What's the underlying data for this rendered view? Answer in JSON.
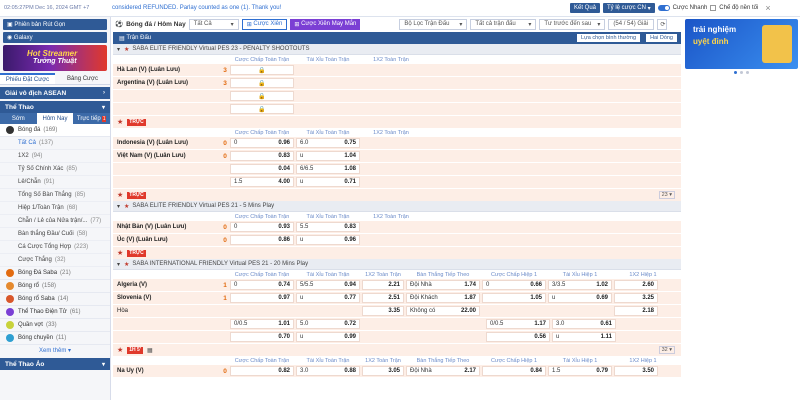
{
  "topbar": {
    "clock": "02:05:27PM Dec 16, 2024 GMT +7",
    "notice": "considered REFUNDED. Parlay counted as one (1). Thank you!",
    "result_btn": "Kết Quả",
    "rate_select": "Tỷ lệ cược CN",
    "fast_bet": "Cược Nhanh",
    "bg_mode": "Chế độ nền tối"
  },
  "sidebar": {
    "btn1": "Phiên bản Rút Gọn",
    "btn2": "Galaxy",
    "banner_line1": "Hot Streamer",
    "banner_line2": "Tưởng Thuật",
    "tab_betslip": "Phiếu Đặt Cược",
    "tab_statement": "Bảng Cược",
    "asean": "Giải vô địch ASEAN",
    "sports": "Thể Thao",
    "sports_tabs": [
      "Sớm",
      "Hôm Nay",
      "Trực tiếp"
    ],
    "live_count": "1",
    "soccer": {
      "label": "Bóng đá",
      "count": "(169)"
    },
    "soccer_subs": [
      {
        "label": "Tất Cả",
        "count": "(137)"
      },
      {
        "label": "1X2",
        "count": "(94)"
      },
      {
        "label": "Tỷ Số Chính Xác",
        "count": "(85)"
      },
      {
        "label": "Lẻ/Chẵn",
        "count": "(91)"
      },
      {
        "label": "Tổng Số Bàn Thắng",
        "count": "(85)"
      },
      {
        "label": "Hiệp 1/Toàn Trận",
        "count": "(68)"
      },
      {
        "label": "Chẵn / Lẻ của Nửa trận/...",
        "count": "(77)"
      },
      {
        "label": "Bàn thắng Đầu/ Cuối",
        "count": "(58)"
      },
      {
        "label": "Cá Cược Tổng Hợp",
        "count": "(223)"
      },
      {
        "label": "Cược Thắng",
        "count": "(32)"
      }
    ],
    "others": [
      {
        "label": "Bóng Đá Saba",
        "count": "(21)",
        "color": "#e26b10"
      },
      {
        "label": "Bóng rổ",
        "count": "(158)",
        "color": "#e58a2f"
      },
      {
        "label": "Bóng rổ Saba",
        "count": "(14)",
        "color": "#d9572b"
      },
      {
        "label": "Thể Thao Điện Tử",
        "count": "(61)",
        "color": "#7b3fd4"
      },
      {
        "label": "Quần vợt",
        "count": "(33)",
        "color": "#c8d23b"
      },
      {
        "label": "Bóng chuyền",
        "count": "(11)",
        "color": "#2f9fd1"
      }
    ],
    "see_more": "Xem thêm",
    "virtual": "Thể Thao Ảo"
  },
  "toolbar": {
    "sport": "Bóng đá / Hôm Nay",
    "filter": "Tất Cả",
    "parlay": "Cược Xiên",
    "lucky_parlay": "Cược Xiên May Mắn",
    "league_filter": "Bộ Lọc Trận Đấu",
    "bet_type": "Tất cả trận đấu",
    "sort": "Tư trước đến sau",
    "count": "(54 / 54) Giải"
  },
  "subbar": {
    "title": "Trận Đấu",
    "opt1": "Lựa chọn bình thường",
    "opt2": "Hai Dòng"
  },
  "sections": [
    {
      "league": "SABA ELITE FRIENDLY Virtual PES 23 - PENALTY SHOOTOUTS",
      "cols": [
        "Cược Chấp Toàn Trận",
        "Tài Xỉu Toàn Trận",
        "1X2 Toàn Trận"
      ]
    },
    {
      "league": "SABA ELITE FRIENDLY Virtual PES 21 - 5 Mins Play",
      "cols": [
        "Cược Chấp Toàn Trận",
        "Tài Xỉu Toàn Trận",
        "1X2 Toàn Trận"
      ]
    },
    {
      "league": "SABA INTERNATIONAL FRIENDLY Virtual PES 21 - 20 Mins Play",
      "cols": [
        "Cược Chấp Toàn Trận",
        "Tài Xỉu Toàn Trận",
        "1X2 Toàn Trận",
        "Bàn Thắng Tiếp Theo",
        "Cược Chấp Hiệp 1",
        "Tài Xỉu Hiệp 1",
        "1X2 Hiệp 1"
      ]
    }
  ],
  "match1": {
    "home": "Hà Lan (V) (Luân Lưu)",
    "away": "Argentina (V) (Luân Lưu)",
    "s1": "3",
    "s2": "3"
  },
  "match2": {
    "home": "Indonesia (V) (Luân Lưu)",
    "away": "Việt Nam (V) (Luân Lưu)",
    "s1": "0",
    "s2": "0",
    "r1": [
      "0",
      "0.96",
      "6.0",
      "0.75"
    ],
    "r2": [
      "",
      "0.83",
      "u",
      "1.04"
    ],
    "r3": [
      "",
      "0.04",
      "6/6.5",
      "1.08"
    ],
    "r4": [
      "1.5",
      "4.00",
      "u",
      "0.71"
    ],
    "page": "23"
  },
  "match3": {
    "home": "Nhật Bản (V) (Luân Lưu)",
    "away": "Úc (V) (Luân Lưu)",
    "s1": "0",
    "s2": "0",
    "r1": [
      "0",
      "0.93",
      "5.5",
      "0.83"
    ],
    "r2": [
      "",
      "0.86",
      "u",
      "0.96"
    ]
  },
  "match4": {
    "home": "Algeria (V)",
    "away": "Slovenia (V)",
    "draw": "Hòa",
    "s1": "1",
    "s2": "1",
    "r1": [
      "0",
      "0.74",
      "5/5.5",
      "0.94",
      "2.21",
      "Đội Nhà",
      "1.74",
      "0",
      "0.66",
      "3/3.5",
      "1.02",
      "2.60"
    ],
    "r2": [
      "",
      "0.97",
      "u",
      "0.77",
      "2.51",
      "Đội Khách",
      "1.87",
      "",
      "1.05",
      "u",
      "0.69",
      "3.25"
    ],
    "r3": [
      "3.35",
      "Không có",
      "22.00",
      "2.18"
    ],
    "r4": [
      "0/0.5",
      "1.01",
      "5.0",
      "0.72",
      "0/0.5",
      "1.17",
      "3.0",
      "0.61"
    ],
    "r5": [
      "",
      "0.70",
      "u",
      "0.99",
      "",
      "0.56",
      "u",
      "1.11"
    ],
    "live": "1H 5'",
    "page": "32"
  },
  "match5": {
    "home": "Na Uy (V)",
    "s1": "0",
    "r1": [
      "0.82",
      "3.0",
      "0.88",
      "3.05",
      "Đội Nhà",
      "2.17",
      "0.84",
      "1.5",
      "0.79",
      "3.50"
    ]
  },
  "live_label": "TRỰC",
  "right": {
    "banner1": "trải nghiệm",
    "banner2": "uyệt đỉnh"
  }
}
